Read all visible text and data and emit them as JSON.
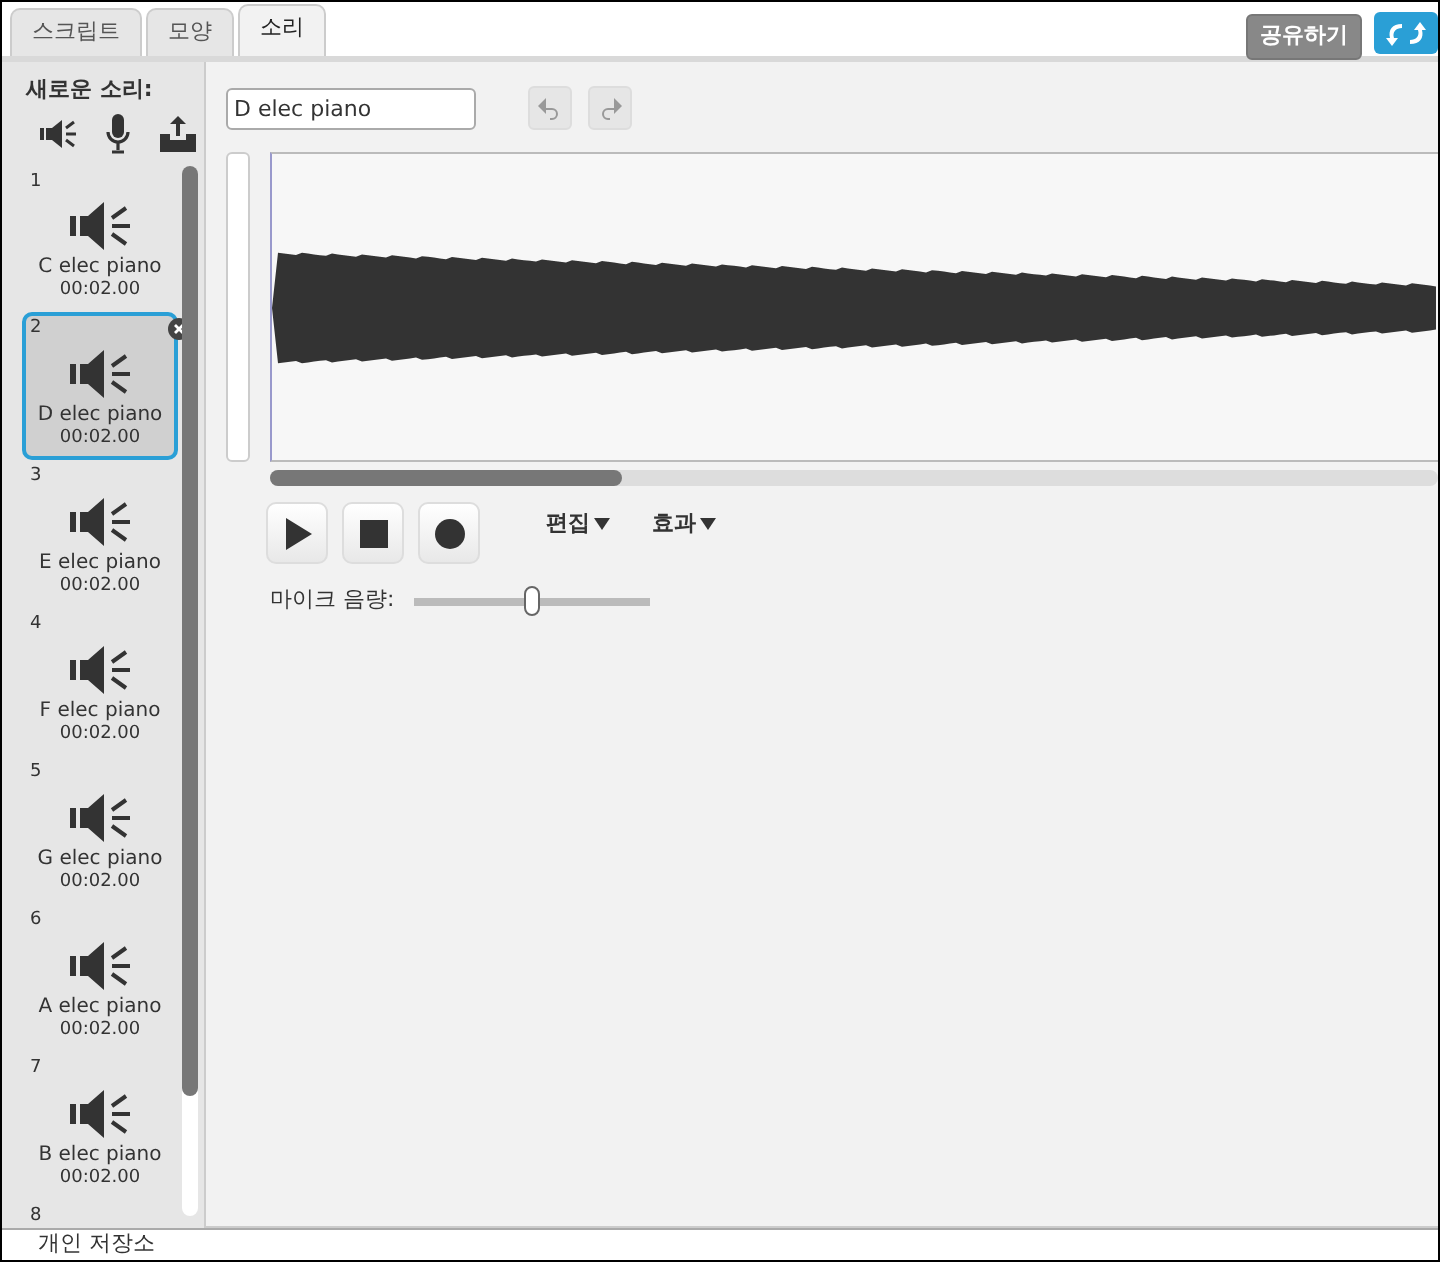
{
  "tabs": [
    {
      "label": "스크립트",
      "selected": false
    },
    {
      "label": "모양",
      "selected": false
    },
    {
      "label": "소리",
      "selected": true
    }
  ],
  "share_button": "공유하기",
  "new_sound": {
    "label": "새로운 소리:"
  },
  "sounds": [
    {
      "number": "1",
      "name": "C elec piano",
      "duration": "00:02.00",
      "selected": false
    },
    {
      "number": "2",
      "name": "D elec piano",
      "duration": "00:02.00",
      "selected": true
    },
    {
      "number": "3",
      "name": "E elec piano",
      "duration": "00:02.00",
      "selected": false
    },
    {
      "number": "4",
      "name": "F elec piano",
      "duration": "00:02.00",
      "selected": false
    },
    {
      "number": "5",
      "name": "G elec piano",
      "duration": "00:02.00",
      "selected": false
    },
    {
      "number": "6",
      "name": "A elec piano",
      "duration": "00:02.00",
      "selected": false
    },
    {
      "number": "7",
      "name": "B elec piano",
      "duration": "00:02.00",
      "selected": false
    },
    {
      "number": "8",
      "selected": false
    }
  ],
  "editor": {
    "name_value": "D elec piano",
    "menus": [
      "편집",
      "효과"
    ],
    "mic_label": "마이크 음량:",
    "level": 0.5
  },
  "backpack": {
    "label": "개인 저장소"
  }
}
